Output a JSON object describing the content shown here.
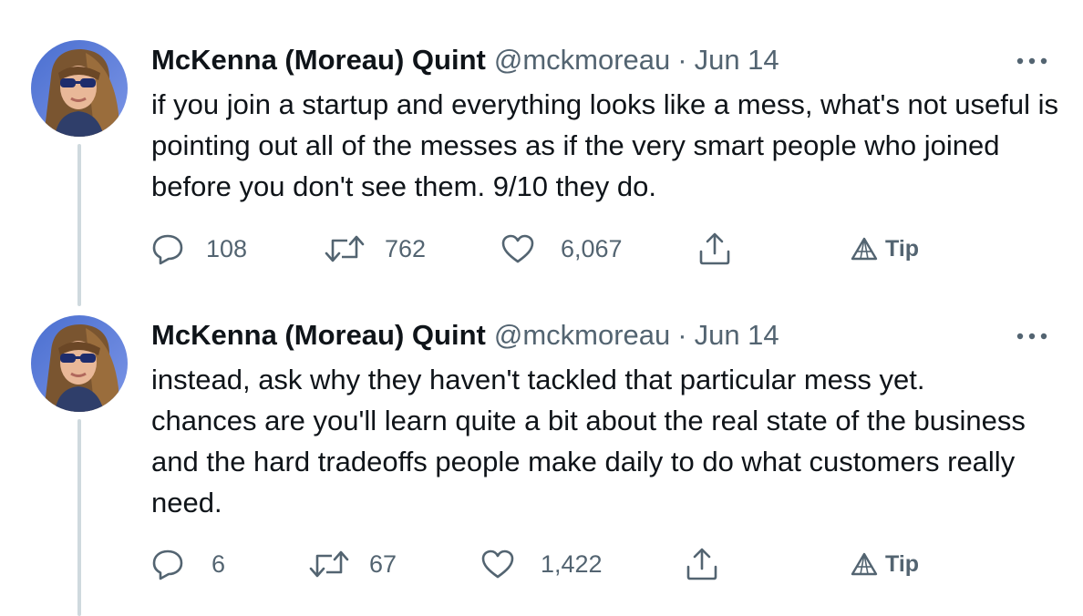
{
  "tweets": [
    {
      "author_name": "McKenna (Moreau) Quint",
      "handle": "@mckmoreau",
      "separator": "·",
      "date": "Jun 14",
      "text": "if you join a startup and everything looks like a mess, what's not useful is pointing out all of the messes as if the very smart people who joined before you don't see them. 9/10 they do.",
      "replies": "108",
      "retweets": "762",
      "likes": "6,067",
      "tip_label": "Tip"
    },
    {
      "author_name": "McKenna (Moreau) Quint",
      "handle": "@mckmoreau",
      "separator": "·",
      "date": "Jun 14",
      "text": "instead, ask why they haven't tackled that particular mess yet. chances are you'll learn quite a bit about the real state of the business and the hard tradeoffs people make daily to do what customers really need.",
      "replies": "6",
      "retweets": "67",
      "likes": "1,422",
      "tip_label": "Tip"
    }
  ],
  "icons": {
    "reply": "reply-icon",
    "retweet": "retweet-icon",
    "like": "heart-icon",
    "share": "share-icon",
    "tip": "tip-icon",
    "more": "more-icon"
  },
  "colors": {
    "text_primary": "#0f1419",
    "text_secondary": "#536471",
    "thread_line": "#cfd9de"
  }
}
